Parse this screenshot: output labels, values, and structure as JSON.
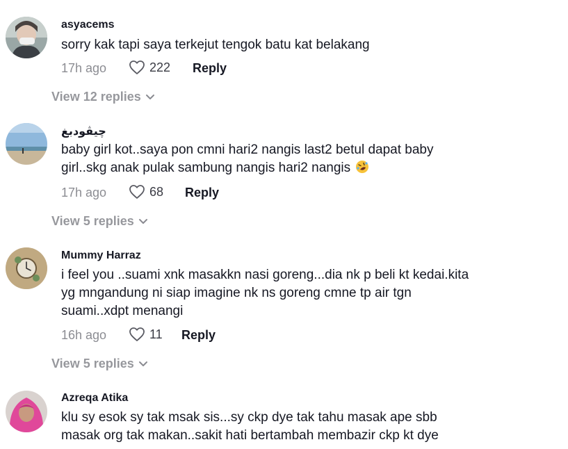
{
  "comments": [
    {
      "username": "asyacems",
      "lines": [
        "sorry kak tapi saya terkejut tengok batu kat belakang"
      ],
      "time": "17h ago",
      "likes": "222",
      "reply_label": "Reply",
      "view_replies": "View 12 replies",
      "avatar_icon": "profile-photo-person"
    },
    {
      "username": "چيڤودبغ",
      "lines": [
        "baby girl kot..saya pon cmni hari2 nangis last2 betul dapat baby",
        "girl..skg anak pulak sambung nangis hari2 nangis"
      ],
      "emoji": "rolling-on-floor-laughing-emoji",
      "time": "17h ago",
      "likes": "68",
      "reply_label": "Reply",
      "view_replies": "View 5 replies",
      "avatar_icon": "profile-photo-beach"
    },
    {
      "username": "Mummy Harraz",
      "lines": [
        "i feel you ..suami xnk masakkn nasi goreng...dia nk p beli kt kedai.kita",
        "yg mngandung ni siap imagine nk ns goreng cmne tp air tgn",
        "suami..xdpt menangi"
      ],
      "time": "16h ago",
      "likes": "11",
      "reply_label": "Reply",
      "view_replies": "View 5 replies",
      "avatar_icon": "profile-photo-clock"
    },
    {
      "username": "Azreqa Atika",
      "lines": [
        "klu sy esok sy tak msak sis...sy ckp dye tak tahu masak ape sbb",
        "masak org tak makan..sakit hati bertambah membazir ckp kt dye"
      ],
      "avatar_icon": "profile-photo-hijab"
    }
  ],
  "colors": {
    "text_primary": "#161823",
    "text_secondary": "#8a8b91",
    "view_replies": "#8a8b91"
  }
}
